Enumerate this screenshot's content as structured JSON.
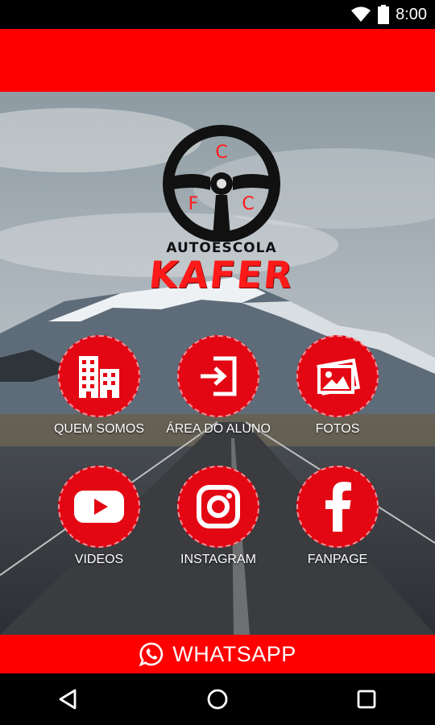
{
  "status_bar": {
    "time": "8:00"
  },
  "logo": {
    "badge_letters": [
      "C",
      "F",
      "C"
    ],
    "subtitle": "AUTOESCOLA",
    "title": "KAFER"
  },
  "menu": [
    {
      "label": "QUEM SOMOS",
      "icon": "building-icon"
    },
    {
      "label": "ÁREA DO ALUNO",
      "icon": "login-icon"
    },
    {
      "label": "FOTOS",
      "icon": "photos-icon"
    },
    {
      "label": "VIDEOS",
      "icon": "youtube-icon"
    },
    {
      "label": "INSTAGRAM",
      "icon": "instagram-icon"
    },
    {
      "label": "FANPAGE",
      "icon": "facebook-icon"
    }
  ],
  "whatsapp": {
    "label": "WHATSAPP",
    "icon": "whatsapp-icon"
  },
  "nav": [
    "back-icon",
    "home-icon",
    "recents-icon"
  ],
  "colors": {
    "brand_red": "#ff0000",
    "button_red": "#e30613"
  }
}
